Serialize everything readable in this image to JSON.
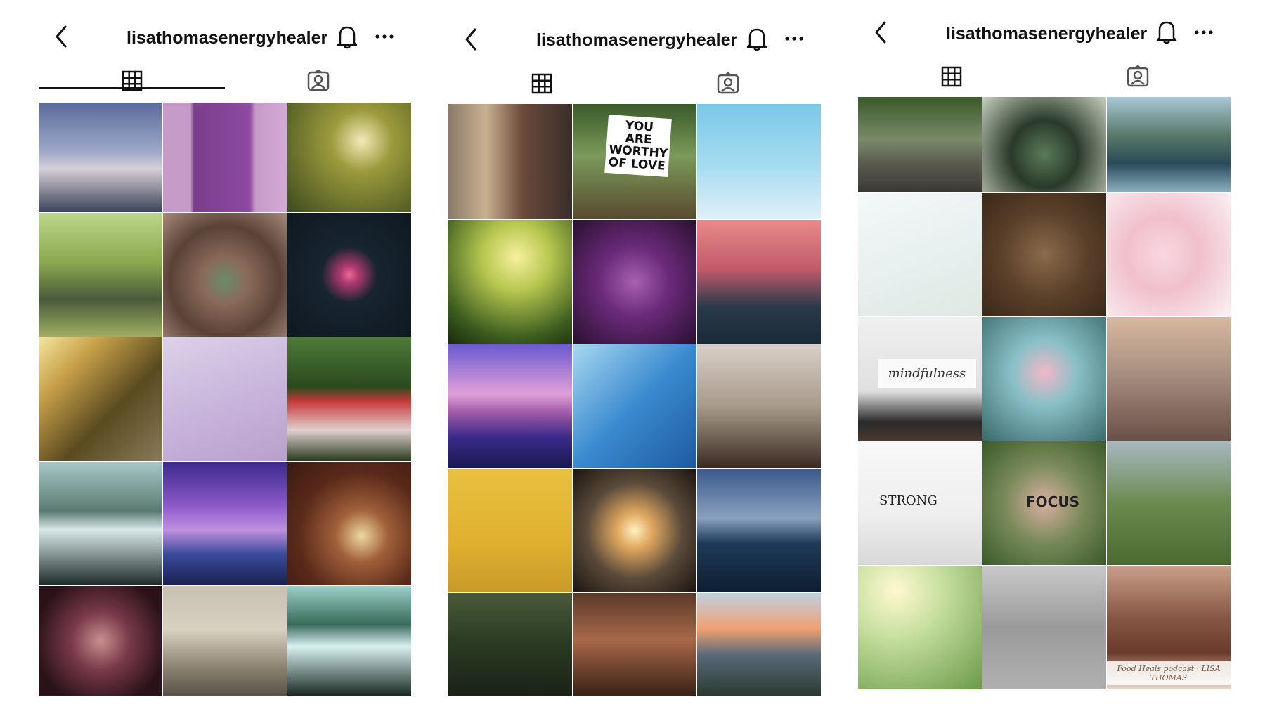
{
  "panels": [
    {
      "username": "lisathomasenergyhealer",
      "tabs": [
        "grid-tab",
        "tagged-tab"
      ],
      "posts": [
        {
          "subject": "karate kick silhouette on beach at dusk",
          "bg": "linear-gradient(180deg,#5a6c9c 0%,#9ea8c8 45%,#d8d0d8 60%,#3a4258 100%)"
        },
        {
          "subject": "purple window shutters on lilac wall",
          "bg": "linear-gradient(90deg,#c79bc7 0%,#c79bc7 22%,#7a3e8c 25%,#8c4aa0 70%,#c79bc7 75%,#d3a9d6 100%)"
        },
        {
          "subject": "woman in red dress dancing in forest",
          "bg": "radial-gradient(circle at 60% 35%,#f5e9b8 0%,#9b9a3c 30%,#3c4a1e 100%)"
        },
        {
          "subject": "woman riding bicycle in park",
          "bg": "linear-gradient(180deg,#bcd78a 0%,#8aa84e 40%,#4a5a3a 70%,#9fae62 100%)"
        },
        {
          "subject": "green leaf on lichen rock",
          "bg": "radial-gradient(circle at 50% 55%,#6a8c6a 0%,#8a6a5a 25%,#5a4238 60%,#a88a7a 100%)"
        },
        {
          "subject": "sparkler heart on dark background",
          "bg": "radial-gradient(circle at 50% 50%,#e86a9a 0%,#b03a70 10%,#182430 32%,#0e1820 100%)"
        },
        {
          "subject": "person walking down sunny tree road",
          "bg": "linear-gradient(135deg,#f5e4a0 0%,#c8a24a 25%,#5a4a20 60%,#8a7a58 100%)"
        },
        {
          "subject": "lavender flowers flat lay",
          "bg": "linear-gradient(160deg,#ddd0e8 0%,#c9b6dc 50%,#b9a0cc 100%)"
        },
        {
          "subject": "girl holding basket of strawberries",
          "bg": "linear-gradient(180deg,#4e7a3a 0%,#2a4a1e 40%,#c83a3a 52%,#e0d0d0 75%,#2a3a1e 100%)"
        },
        {
          "subject": "waterfall in misty forest",
          "bg": "linear-gradient(180deg,#a8c8c8 0%,#5a7a70 40%,#d8e8e8 55%,#1e2a2a 100%)"
        },
        {
          "subject": "purple sunset over rocky shore",
          "bg": "linear-gradient(180deg,#3a2a8a 0%,#8a58c8 35%,#c090e0 55%,#3a4a9a 75%,#1a2050 100%)"
        },
        {
          "subject": "hand holding glowing jar of lights",
          "bg": "radial-gradient(circle at 60% 60%,#f0d8a0 0%,#a0603a 25%,#5a2a1a 60%,#3a1a12 100%)"
        },
        {
          "subject": "woman praying with eyes closed",
          "bg": "radial-gradient(circle at 50% 50%,#c89090 0%,#7a3a4a 35%,#2a1218 80%)"
        },
        {
          "subject": "woman with red scarf in city",
          "bg": "linear-gradient(180deg,#c8c0b0 0%,#d8d0c0 40%,#8a8070 75%,#5a5448 100%)"
        },
        {
          "subject": "waterfall in teal forest",
          "bg": "linear-gradient(180deg,#9ad0c8 0%,#3a6a5a 35%,#d8f0f0 55%,#1a2a22 100%)"
        }
      ]
    },
    {
      "username": "lisathomasenergyhealer",
      "tabs": [
        "grid-tab",
        "tagged-tab"
      ],
      "posts": [
        {
          "subject": "woman praying against brick wall",
          "bg": "linear-gradient(90deg,#8a7a6a 0%,#c8b090 30%,#6a4a3a 60%,#3a2e2a 100%)"
        },
        {
          "subject": "YOU ARE WORTHY OF LOVE sign on tree",
          "bg": "linear-gradient(180deg,#3a5a2a 0%,#7a9a5a 45%,#5a4a30 100%)",
          "caption": "YOU ARE\nWORTHY\nOF LOVE"
        },
        {
          "subject": "hot air balloons in blue sky",
          "bg": "linear-gradient(180deg,#7ac8e8 0%,#a8dcf0 55%,#e0f0f8 100%)"
        },
        {
          "subject": "sunlit green leaves",
          "bg": "radial-gradient(circle at 55% 30%,#f8f0a0 0%,#b8c850 30%,#3a5a1e 75%,#1a2a0e 100%)"
        },
        {
          "subject": "purple lilac blossoms",
          "bg": "radial-gradient(circle at 50% 50%,#a860b0 0%,#6a2a7a 40%,#2a1030 100%)"
        },
        {
          "subject": "woman holding lantern at sunset",
          "bg": "linear-gradient(180deg,#e88a8a 0%,#c05a6a 40%,#2a3a4a 70%,#1a2a38 100%)"
        },
        {
          "subject": "pink purple sunset over water",
          "bg": "linear-gradient(180deg,#6a5ad0 0%,#e0a0d8 40%,#a05aa8 55%,#3a2a8a 75%,#1a1a50 100%)"
        },
        {
          "subject": "red shoes climbing blue stairs",
          "bg": "linear-gradient(135deg,#a8d8f0 0%,#3a8ad0 50%,#1e5aa0 100%)"
        },
        {
          "subject": "chess pieces on board",
          "bg": "linear-gradient(180deg,#d8d0c8 0%,#a89a8a 50%,#3a2a22 100%)"
        },
        {
          "subject": "woman with umbrella on yellow wall",
          "bg": "linear-gradient(180deg,#e8c040 0%,#e0b030 60%,#c89a28 100%)"
        },
        {
          "subject": "silhouette meditating at sunrise",
          "bg": "radial-gradient(circle at 50% 50%,#fff0c0 0%,#e0a860 20%,#5a4a3a 55%,#1a1410 100%)"
        },
        {
          "subject": "lone tree in lake with mountains",
          "bg": "linear-gradient(180deg,#3a5a8a 0%,#8aa0c0 40%,#1e3a5a 60%,#0e1e30 100%)"
        },
        {
          "subject": "misty forest path",
          "bg": "linear-gradient(180deg,#4a5a3a 0%,#2a3a22 50%,#1a2218 100%)"
        },
        {
          "subject": "crystal ball in palm under arches",
          "bg": "linear-gradient(180deg,#5a3a2a 0%,#a8684a 45%,#3a2218 100%)"
        },
        {
          "subject": "sunset over hills",
          "bg": "linear-gradient(180deg,#c0d0e0 0%,#f0a070 35%,#5a6a7a 60%,#2a3a30 100%)"
        }
      ]
    },
    {
      "username": "lisathomasenergyhealer",
      "tabs": [
        "grid-tab",
        "tagged-tab"
      ],
      "posts": [
        {
          "subject": "boulders in forest stream",
          "bg": "linear-gradient(180deg,#3a5a2a 0%,#7a8a6a 45%,#5a5a50 70%,#3a3a34 100%)"
        },
        {
          "subject": "finger touching water ripples",
          "bg": "radial-gradient(circle at 50% 60%,#5a7a5a 0%,#2a3a2a 40%,#c8d0c0 100%)"
        },
        {
          "subject": "fjord landscape with cliffs",
          "bg": "linear-gradient(180deg,#a8c8d8 0%,#5a7a6a 40%,#2a4a5a 70%,#8ab0c0 100%)"
        },
        {
          "subject": "white flowers on white",
          "bg": "linear-gradient(160deg,#f4f8f8 0%,#e6eeee 60%,#dfe8e0 100%)"
        },
        {
          "subject": "green leaf on tree stump rings",
          "bg": "radial-gradient(circle at 50% 50%,#8a6a4a 0%,#5a402a 50%,#3a2818 100%)"
        },
        {
          "subject": "pink cherry blossoms",
          "bg": "radial-gradient(circle at 45% 50%,#f8d8e0 0%,#f0c0cc 40%,#faf0f2 100%)"
        },
        {
          "subject": "mindfulness card on windowsill",
          "bg": "linear-gradient(180deg,#f0f0f0 0%,#e0e0e0 60%,#2a2a2a 85%,#4a3a30 100%)",
          "caption": "mindfulness"
        },
        {
          "subject": "pink lotus on lily pads",
          "bg": "radial-gradient(circle at 50% 45%,#f0b8c8 0%,#8ac0c8 35%,#3a6a6a 100%)"
        },
        {
          "subject": "stacked zen stones at dusk",
          "bg": "linear-gradient(180deg,#d8b8a0 0%,#a89080 45%,#6a5048 100%)"
        },
        {
          "subject": "BE STRONG coffee mug",
          "bg": "linear-gradient(180deg,#f8f8f8 0%,#eeeeee 60%,#d8d8d8 100%)",
          "caption": "STRONG"
        },
        {
          "subject": "FOCUS written on fist",
          "bg": "radial-gradient(circle at 50% 50%,#d8b0a0 0%,#7a8a5a 45%,#3a5a2a 100%)",
          "caption": "FOCUS"
        },
        {
          "subject": "woman jumping on rocks by hills",
          "bg": "linear-gradient(180deg,#a8b8c0 0%,#6a8a50 50%,#4a6a30 100%)"
        },
        {
          "subject": "woman in hat in sunny meadow",
          "bg": "radial-gradient(circle at 30% 20%,#fff8d0 0%,#c8e0a0 35%,#6a9a4a 100%)"
        },
        {
          "subject": "sprout growing from sand",
          "bg": "linear-gradient(180deg,#c8c8c8 0%,#9a9a9a 50%,#b0b0b0 100%)"
        },
        {
          "subject": "Lisa Thomas Food Heals podcast portrait",
          "bg": "linear-gradient(180deg,#c8a088 0%,#8a5a48 40%,#6a3a2a 70%,#e8d8c8 100%)",
          "caption": "Food Heals podcast · LISA THOMAS"
        }
      ]
    }
  ]
}
